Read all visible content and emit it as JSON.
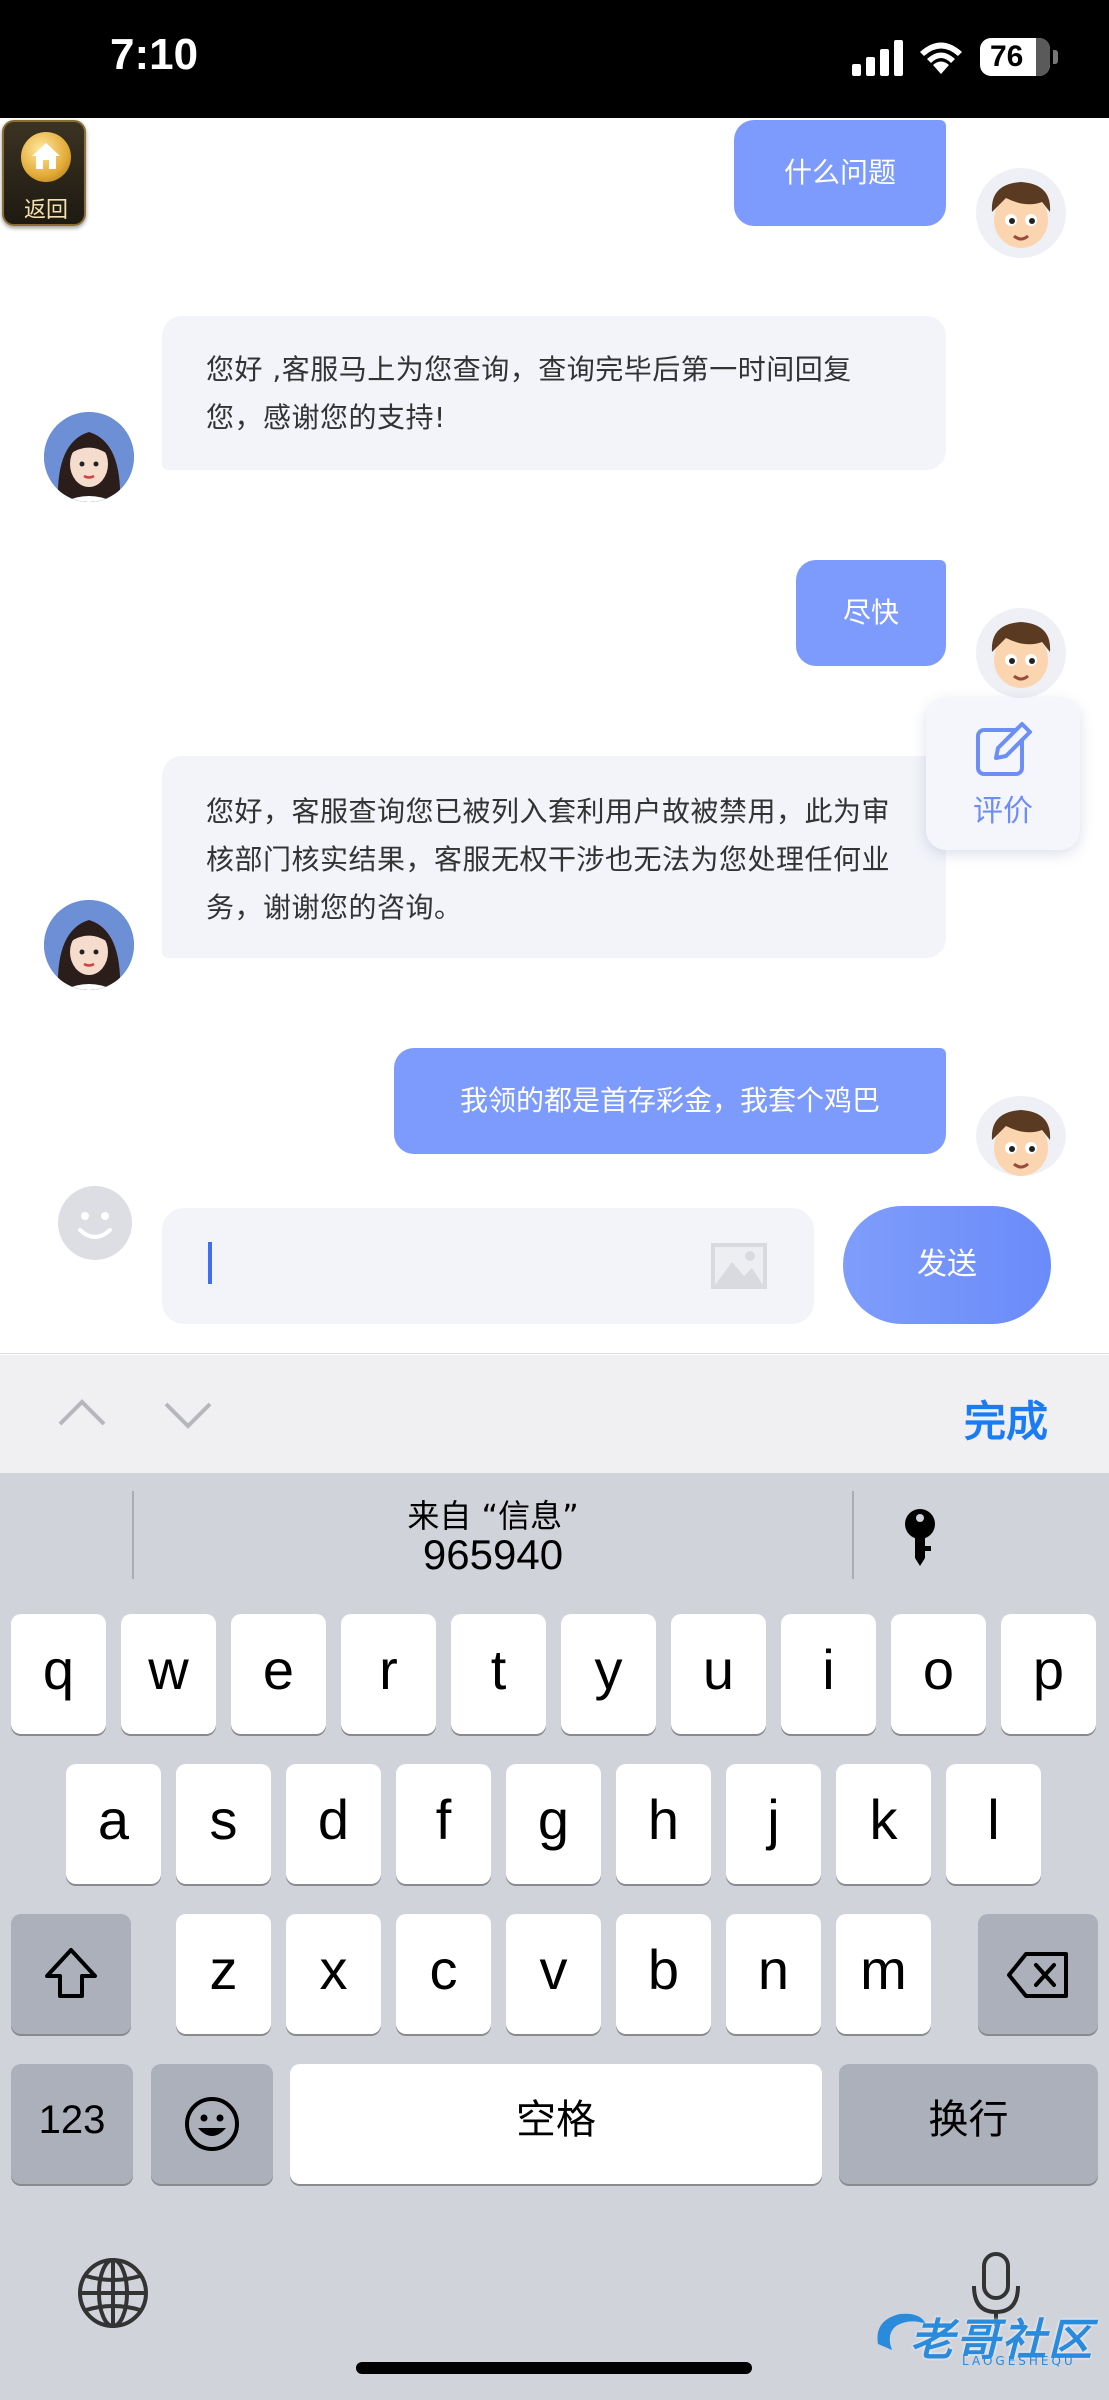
{
  "status_bar": {
    "time": "7:10",
    "battery": "76"
  },
  "back_button": {
    "label": "返回"
  },
  "messages": [
    {
      "sender": "user",
      "text": "什么问题"
    },
    {
      "sender": "agent",
      "text": "您好 ,客服马上为您查询，查询完毕后第一时间回复您，感谢您的支持!"
    },
    {
      "sender": "user",
      "text": "尽快"
    },
    {
      "sender": "agent",
      "text": "您好，客服查询您已被列入套利用户故被禁用，此为审核部门核实结果，客服无权干涉也无法为您处理任何业务，谢谢您的咨询。"
    },
    {
      "sender": "user",
      "text": "我领的都是首存彩金，我套个鸡巴"
    }
  ],
  "rate_button": {
    "label": "评价"
  },
  "composer": {
    "input_value": "",
    "send_label": "发送"
  },
  "accessory_bar": {
    "done_label": "完成"
  },
  "keyboard": {
    "suggestion_source": "来自 “信息”",
    "suggestion_code": "965940",
    "row1": [
      "q",
      "w",
      "e",
      "r",
      "t",
      "y",
      "u",
      "i",
      "o",
      "p"
    ],
    "row2": [
      "a",
      "s",
      "d",
      "f",
      "g",
      "h",
      "j",
      "k",
      "l"
    ],
    "row3": [
      "z",
      "x",
      "c",
      "v",
      "b",
      "n",
      "m"
    ],
    "numbers_label": "123",
    "space_label": "空格",
    "return_label": "换行"
  },
  "watermark": {
    "text": "老哥社区",
    "sub": "LAOGESHEQU"
  },
  "colors": {
    "user_bubble": "#7d9bfc",
    "agent_bubble": "#f2f4f9",
    "accent": "#1a7cf5"
  }
}
